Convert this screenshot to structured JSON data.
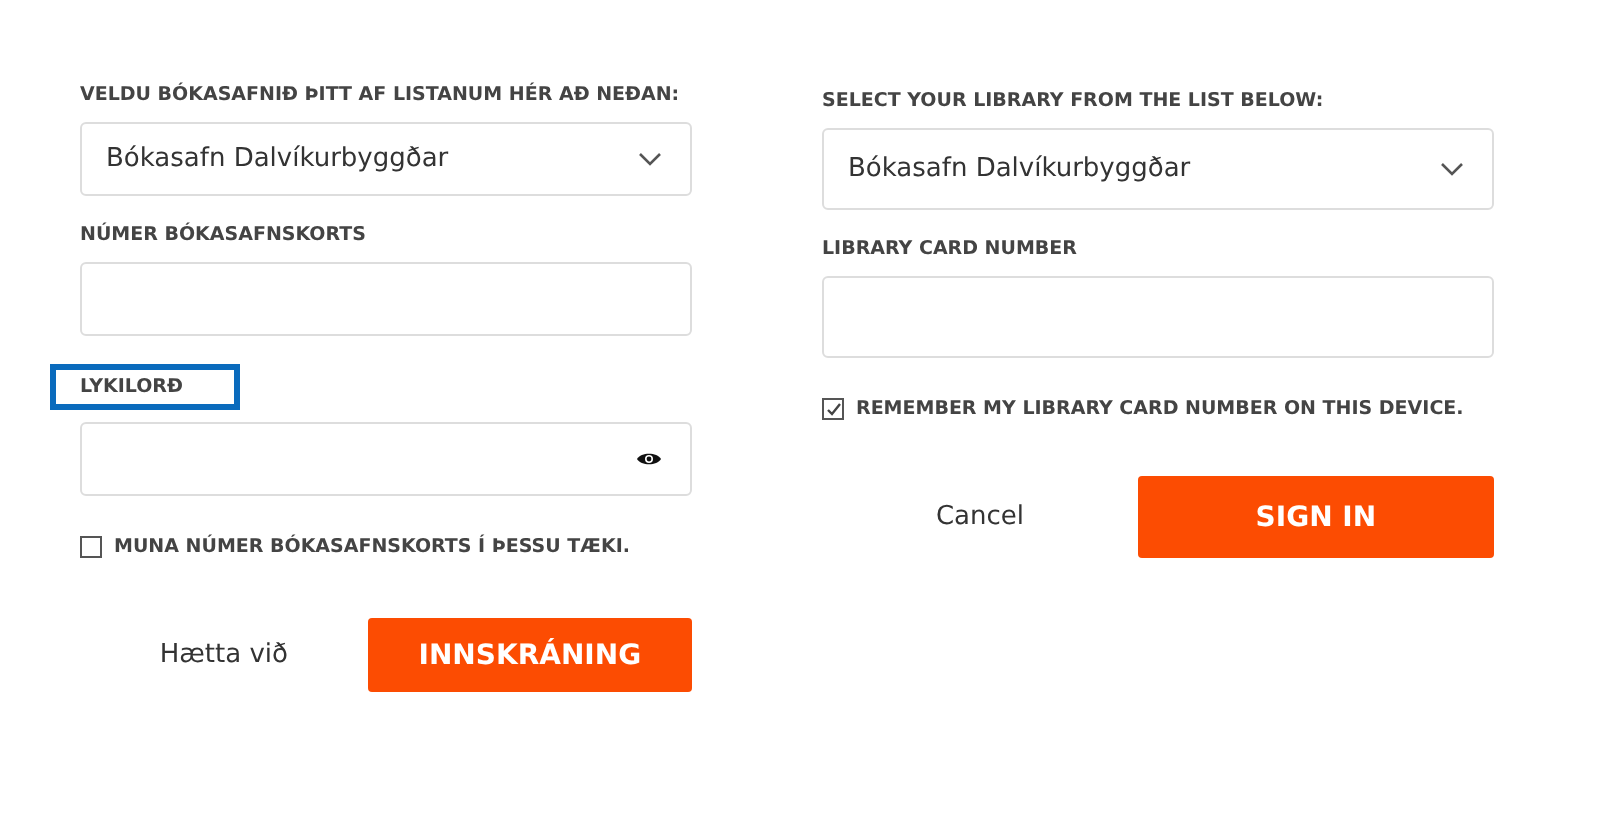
{
  "forms": [
    {
      "fields": [
        {
          "kind": "select",
          "label": "VELDU BÓKASAFNIÐ ÞITT AF LISTANUM HÉR AÐ NEÐAN:",
          "value": "Bókasafn Dalvíkurbyggðar",
          "highlighted": false
        },
        {
          "kind": "text",
          "label": "NÚMER BÓKASAFNSKORTS",
          "highlighted": false
        },
        {
          "kind": "password",
          "label": "LYKILORÐ",
          "highlighted": true
        }
      ],
      "remember": {
        "label": "MUNA NÚMER BÓKASAFNSKORTS Í ÞESSU TÆKI.",
        "checked": false
      },
      "cancel": "Hætta við",
      "submit": "INNSKRÁNING"
    },
    {
      "fields": [
        {
          "kind": "select",
          "label": "SELECT YOUR LIBRARY FROM THE LIST BELOW:",
          "value": "Bókasafn Dalvíkurbyggðar",
          "highlighted": false
        },
        {
          "kind": "text",
          "label": "LIBRARY CARD NUMBER",
          "highlighted": false
        }
      ],
      "remember": {
        "label": "REMEMBER MY LIBRARY CARD NUMBER ON THIS DEVICE.",
        "checked": true
      },
      "cancel": "Cancel",
      "submit": "SIGN IN"
    }
  ]
}
